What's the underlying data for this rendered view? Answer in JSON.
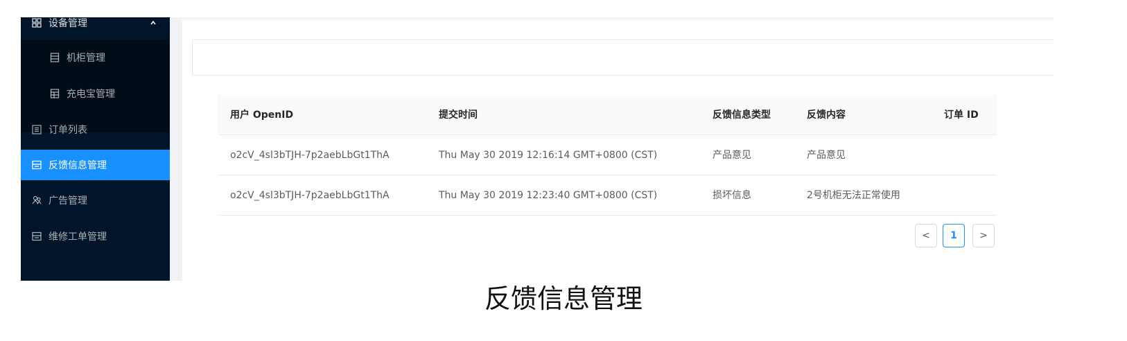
{
  "sidebar": {
    "group_label": "设备管理",
    "items": [
      {
        "label": "机柜管理"
      },
      {
        "label": "充电宝管理"
      },
      {
        "label": "订单列表"
      },
      {
        "label": "反馈信息管理"
      },
      {
        "label": "广告管理"
      },
      {
        "label": "维修工单管理"
      }
    ],
    "active_color": "#1890ff",
    "bg_color": "#001529"
  },
  "table": {
    "columns": [
      "用户 OpenID",
      "提交时间",
      "反馈信息类型",
      "反馈内容",
      "订单 ID"
    ],
    "rows": [
      {
        "openid": "o2cV_4sl3bTJH-7p2aebLbGt1ThA",
        "time": "Thu May 30 2019 12:16:14 GMT+0800 (CST)",
        "type": "产品意见",
        "content": "产品意见",
        "order_id": ""
      },
      {
        "openid": "o2cV_4sl3bTJH-7p2aebLbGt1ThA",
        "time": "Thu May 30 2019 12:23:40 GMT+0800 (CST)",
        "type": "损坏信息",
        "content": "2号机柜无法正常使用",
        "order_id": ""
      }
    ]
  },
  "pagination": {
    "prev": "<",
    "current": "1",
    "next": ">"
  },
  "caption": "反馈信息管理"
}
